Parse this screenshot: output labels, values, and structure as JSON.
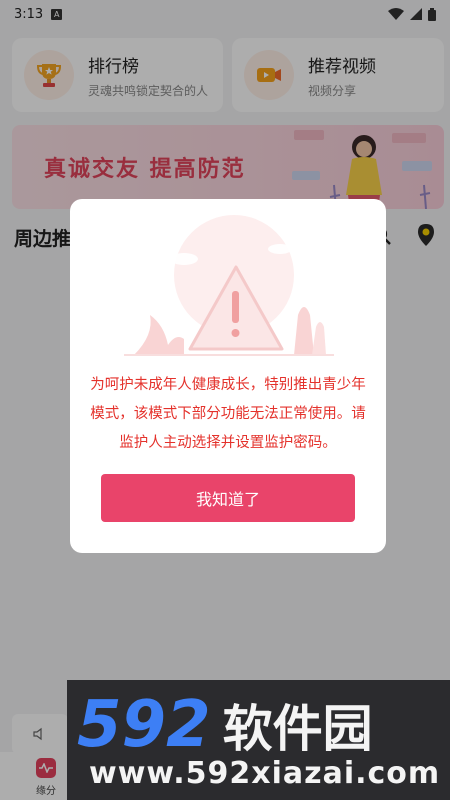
{
  "status_bar": {
    "time": "3:13",
    "notification_glyph": "A"
  },
  "cards": [
    {
      "title": "排行榜",
      "subtitle": "灵魂共鸣锁定契合的人",
      "icon": "trophy-icon"
    },
    {
      "title": "推荐视频",
      "subtitle": "视频分享",
      "icon": "video-camera-icon"
    }
  ],
  "banner": {
    "text": "真诚交友 提高防范"
  },
  "nearby": {
    "title": "周边推"
  },
  "tabbar": {
    "yuanfen_label": "缘分"
  },
  "dialog": {
    "message": "为呵护未成年人健康成长，特别推出青少年模式，该模式下部分功能无法正常使用。请监护人主动选择并设置监护密码。",
    "button_label": "我知道了"
  },
  "watermark": {
    "brand": "592软件园",
    "url": "www.592xiazai.com"
  },
  "colors": {
    "accent": "#e9446a",
    "warning_text": "#e4322c",
    "banner_text": "#e2445c"
  }
}
